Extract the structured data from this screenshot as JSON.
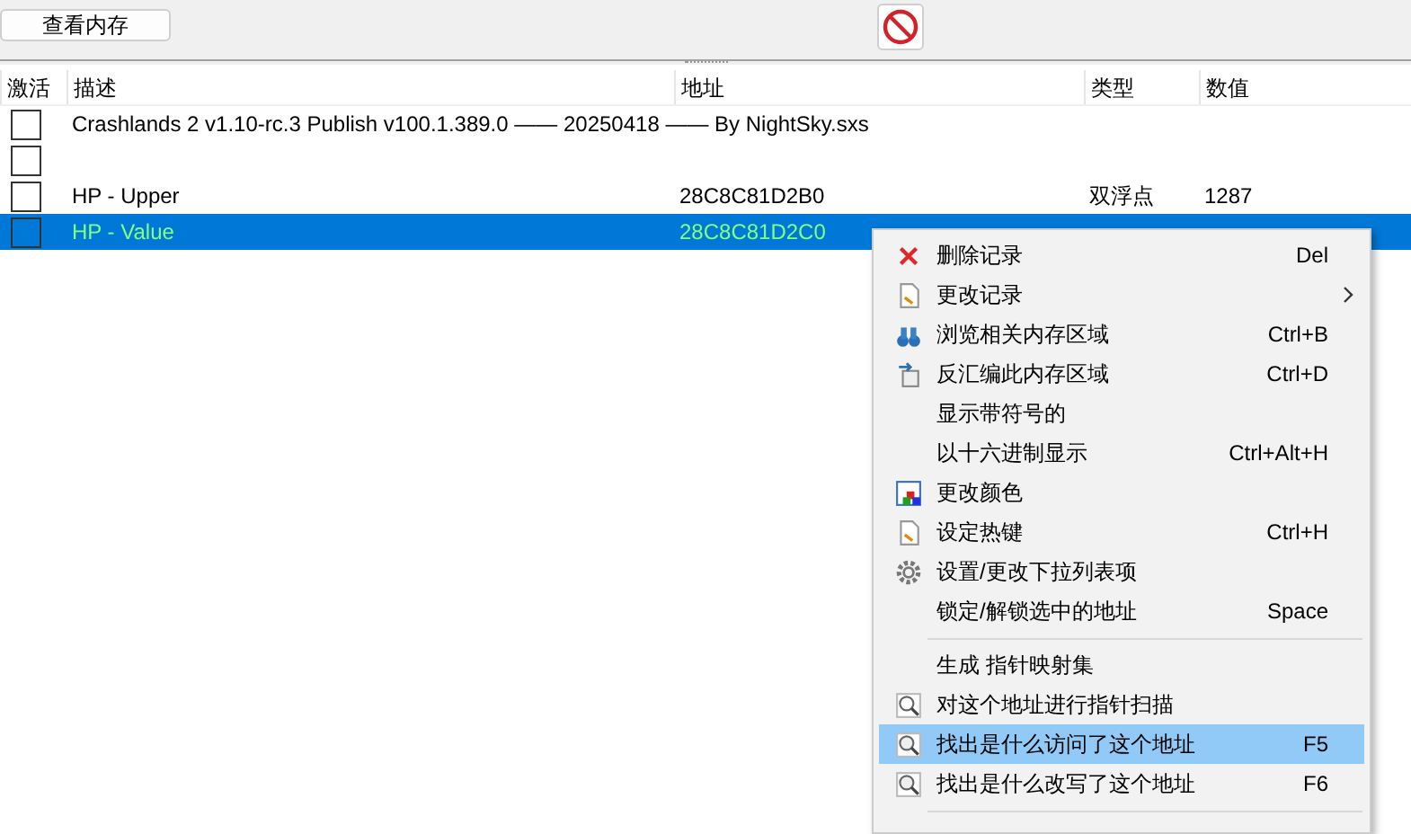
{
  "toolbar": {
    "memory_button": "查看内存"
  },
  "table": {
    "columns": [
      "激活",
      "描述",
      "地址",
      "类型",
      "数值"
    ],
    "rows": [
      {
        "checked": false,
        "selected": false,
        "description": "Crashlands 2 v1.10-rc.3 Publish v100.1.389.0 —— 20250418 —— By NightSky.sxs"
      },
      {
        "checked": false,
        "selected": false
      },
      {
        "checked": false,
        "selected": false,
        "description": "HP - Upper",
        "address": "28C8C81D2B0",
        "type": "双浮点",
        "value": "1287"
      },
      {
        "checked": false,
        "selected": true,
        "description": "HP - Value",
        "address": "28C8C81D2C0"
      }
    ]
  },
  "context_menu": [
    {
      "kind": "item",
      "label": "删除记录",
      "shortcut": "Del",
      "selected": false
    },
    {
      "kind": "item",
      "label": "更改记录",
      "submenu": true,
      "selected": false
    },
    {
      "kind": "item",
      "label": "浏览相关内存区域",
      "shortcut": "Ctrl+B",
      "selected": false
    },
    {
      "kind": "item",
      "label": "反汇编此内存区域",
      "shortcut": "Ctrl+D",
      "selected": false
    },
    {
      "kind": "item",
      "label": "显示带符号的",
      "selected": false
    },
    {
      "kind": "item",
      "label": "以十六进制显示",
      "shortcut": "Ctrl+Alt+H",
      "selected": false
    },
    {
      "kind": "item",
      "label": "更改颜色",
      "selected": false
    },
    {
      "kind": "item",
      "label": "设定热键",
      "shortcut": "Ctrl+H",
      "selected": false
    },
    {
      "kind": "item",
      "label": "设置/更改下拉列表项",
      "selected": false
    },
    {
      "kind": "item",
      "label": "锁定/解锁选中的地址",
      "shortcut": "Space",
      "selected": false
    },
    {
      "kind": "separator"
    },
    {
      "kind": "item",
      "label": "生成 指针映射集",
      "selected": false
    },
    {
      "kind": "item",
      "label": "对这个地址进行指针扫描",
      "selected": false
    },
    {
      "kind": "item",
      "label": "找出是什么访问了这个地址",
      "shortcut": "F5",
      "selected": true
    },
    {
      "kind": "item",
      "label": "找出是什么改写了这个地址",
      "shortcut": "F6",
      "selected": false
    },
    {
      "kind": "separator"
    }
  ]
}
